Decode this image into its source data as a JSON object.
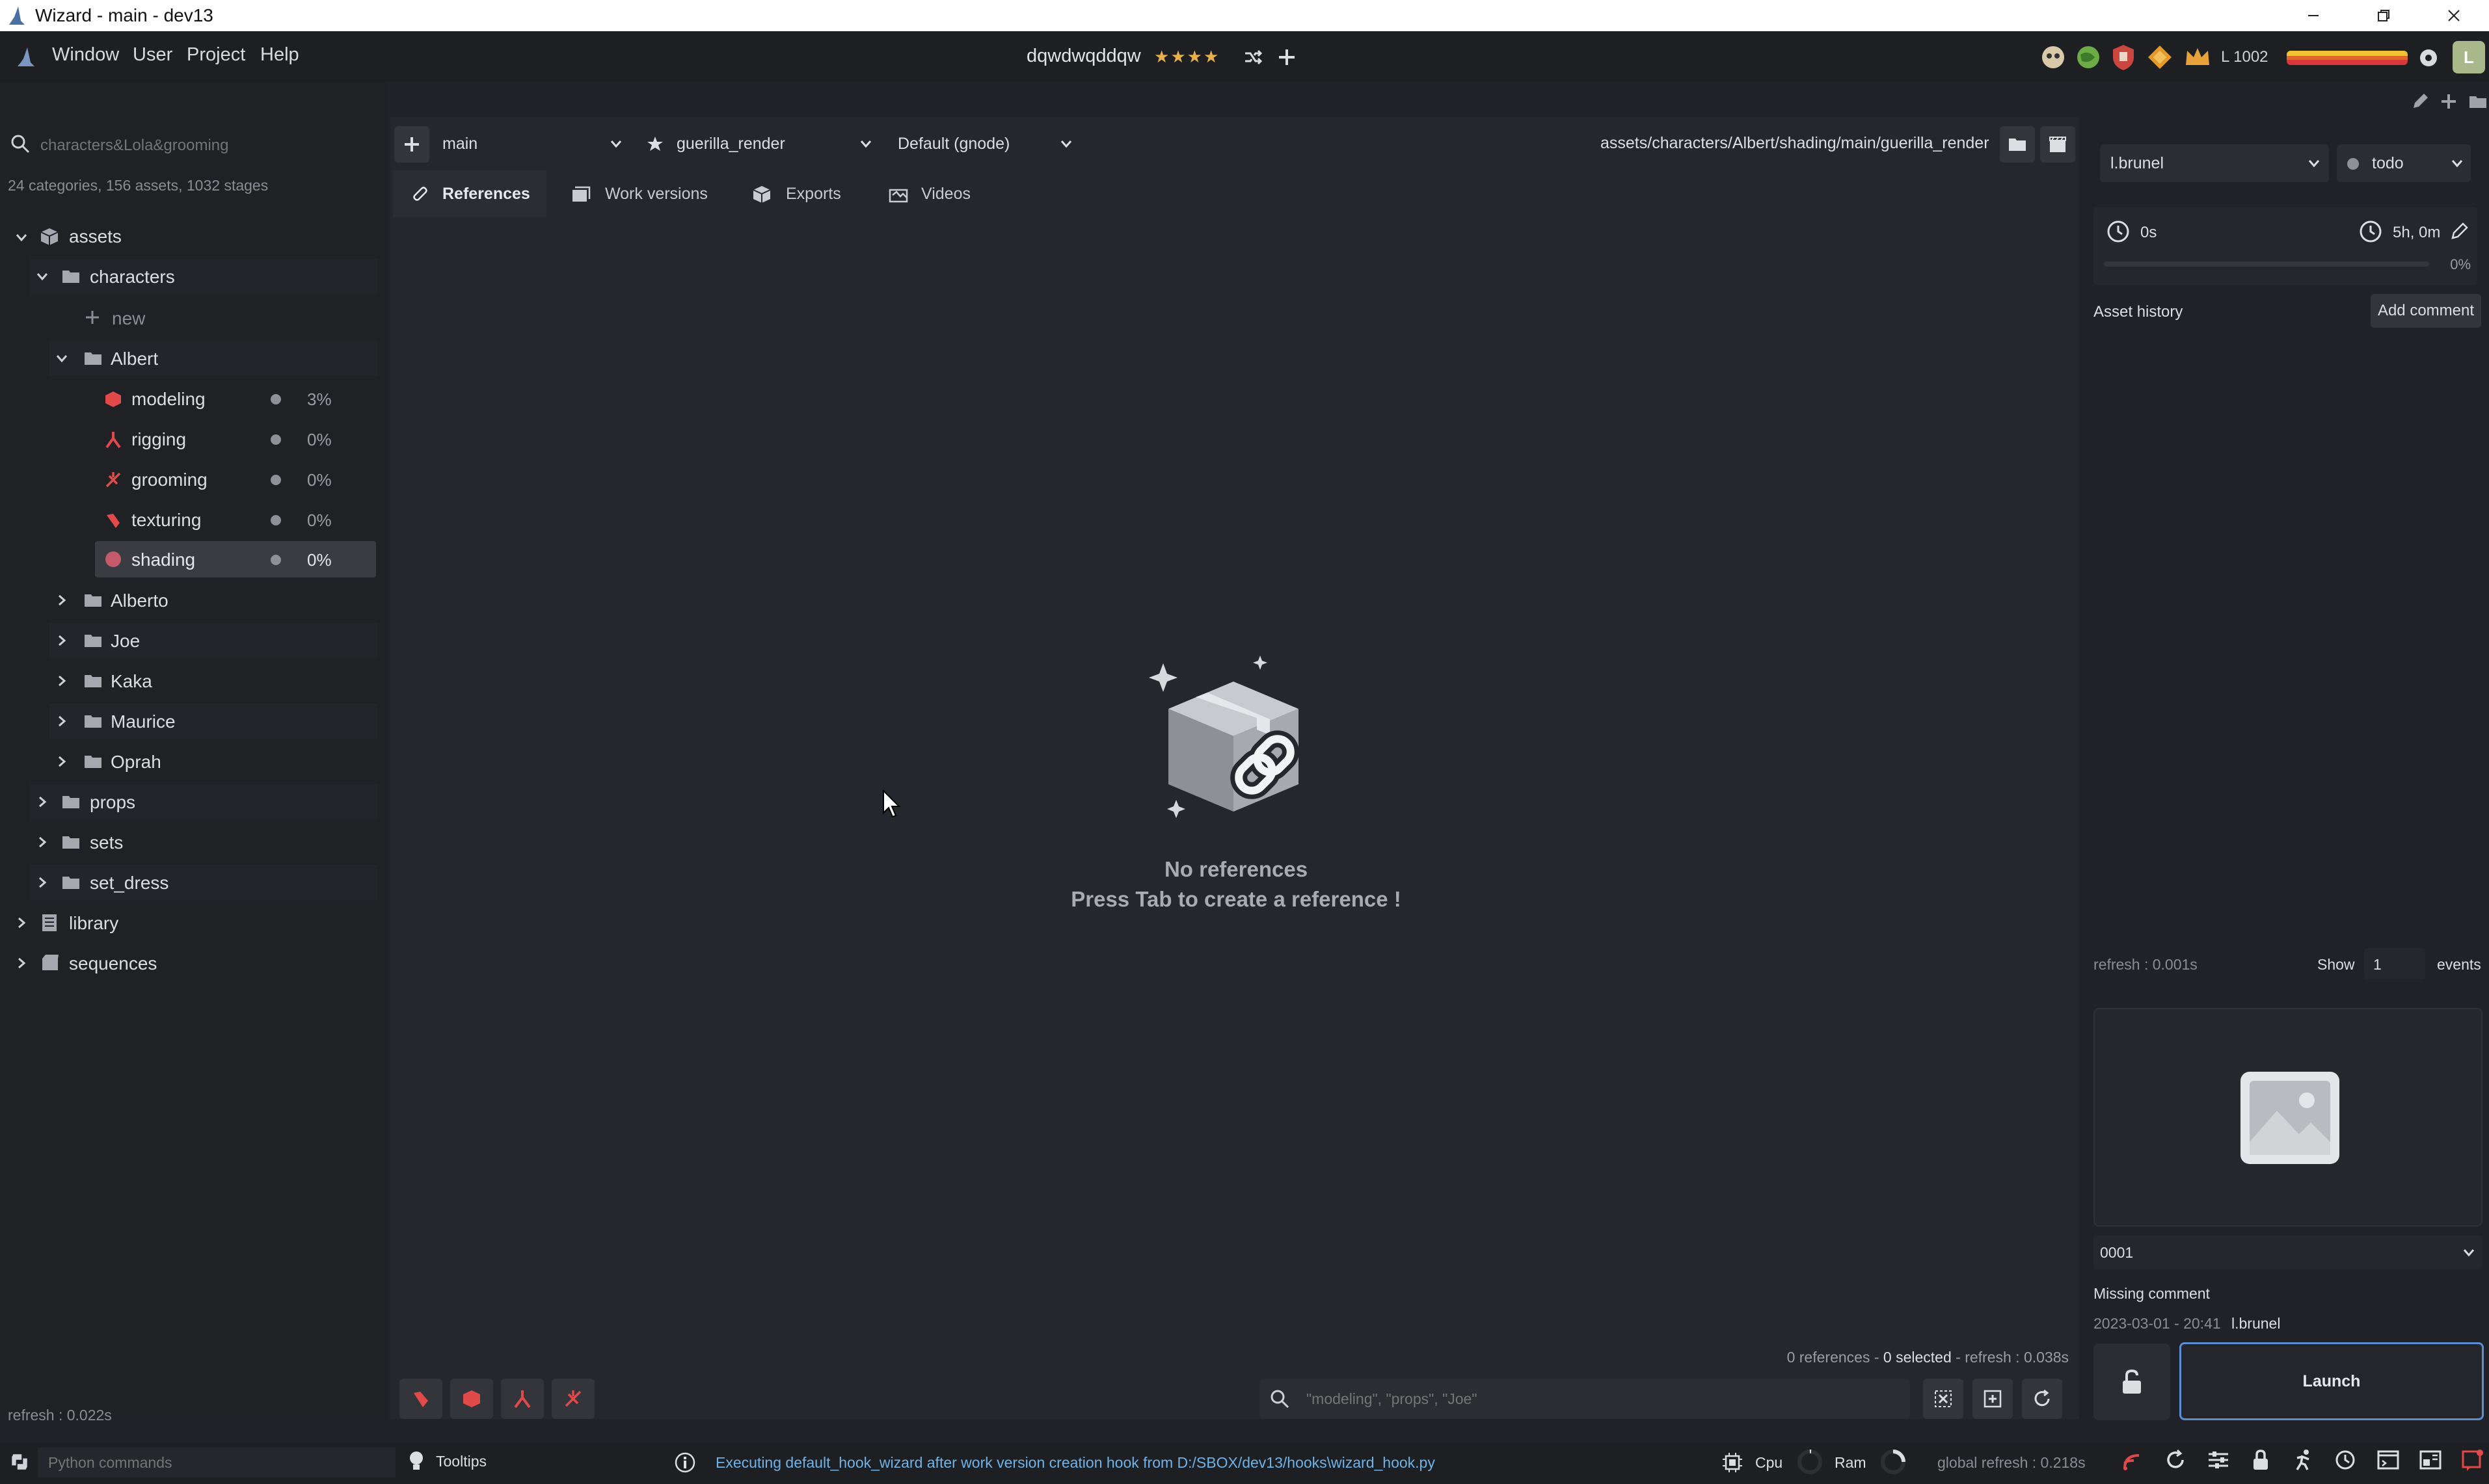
{
  "window": {
    "title": "Wizard - main - dev13"
  },
  "menubar": {
    "items": [
      "Window",
      "User",
      "Project",
      "Help"
    ],
    "project_name": "dqwdwqddqw",
    "stars": [
      "★",
      "★",
      "★",
      "★"
    ],
    "level": "L 1002",
    "avatar_letter": "L",
    "colors": {
      "star": "#e8b04a",
      "accent": "#ef5350"
    }
  },
  "sidebar": {
    "search_placeholder": "characters&Lola&grooming",
    "summary": "24 categories, 156 assets, 1032 stages",
    "tree": [
      {
        "label": "assets",
        "icon": "cube-icon"
      },
      {
        "label": "characters",
        "icon": "folder-icon"
      },
      {
        "label": "new",
        "icon": "plus-icon"
      },
      {
        "label": "Albert",
        "icon": "folder-icon"
      },
      {
        "label": "modeling",
        "icon": "modeling-icon",
        "percent": "3%"
      },
      {
        "label": "rigging",
        "icon": "rigging-icon",
        "percent": "0%"
      },
      {
        "label": "grooming",
        "icon": "grooming-icon",
        "percent": "0%"
      },
      {
        "label": "texturing",
        "icon": "texturing-icon",
        "percent": "0%"
      },
      {
        "label": "shading",
        "icon": "shading-icon",
        "percent": "0%"
      },
      {
        "label": "Alberto",
        "icon": "folder-icon"
      },
      {
        "label": "Joe",
        "icon": "folder-icon"
      },
      {
        "label": "Kaka",
        "icon": "folder-icon"
      },
      {
        "label": "Maurice",
        "icon": "folder-icon"
      },
      {
        "label": "Oprah",
        "icon": "folder-icon"
      },
      {
        "label": "props",
        "icon": "folder-icon"
      },
      {
        "label": "sets",
        "icon": "folder-icon"
      },
      {
        "label": "set_dress",
        "icon": "folder-icon"
      },
      {
        "label": "library",
        "icon": "library-icon"
      },
      {
        "label": "sequences",
        "icon": "sequence-icon"
      }
    ],
    "refresh": "refresh : 0.022s"
  },
  "main": {
    "version_combo": "main",
    "export_combo": "guerilla_render",
    "state_combo": "Default (gnode)",
    "path": "assets/characters/Albert/shading/main/guerilla_render",
    "tabs": [
      "References",
      "Work versions",
      "Exports",
      "Videos"
    ],
    "empty_title": "No references",
    "empty_hint": "Press Tab to create a reference !",
    "footer_counts": "0 references -",
    "footer_selected": "0 selected",
    "footer_refresh": "- refresh : 0.038s",
    "search_placeholder": "\"modeling\", \"props\", \"Joe\""
  },
  "right": {
    "user": "l.brunel",
    "status": "todo",
    "time_spent": "0s",
    "time_estimated": "5h, 0m",
    "progress_label": "0%",
    "progress": 0,
    "history_title": "Asset history",
    "add_comment": "Add comment",
    "refresh": "refresh : 0.001s",
    "show_label": "Show",
    "show_count": "1",
    "events_label": "events",
    "version": "0001",
    "comment": "Missing comment",
    "date": "2023-03-01 - 20:41",
    "author": "l.brunel",
    "launch": "Launch"
  },
  "statusbar": {
    "python_placeholder": "Python commands",
    "tooltips": "Tooltips",
    "message": "Executing default_hook_wizard after work version creation hook from D:/SBOX/dev13/hooks\\wizard_hook.py",
    "cpu": "Cpu",
    "ram": "Ram",
    "global_refresh": "global refresh : 0.218s",
    "colors": {
      "message": "#6fb3e8"
    }
  }
}
